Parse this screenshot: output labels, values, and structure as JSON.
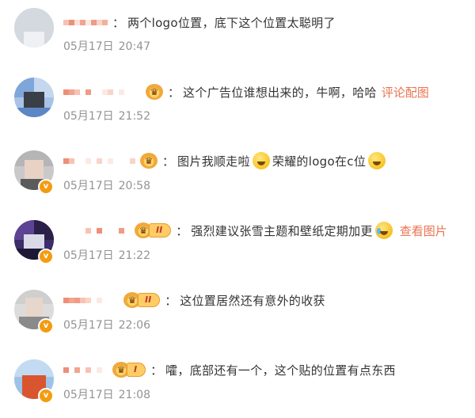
{
  "comments": [
    {
      "text": "两个logo位置，底下这个位置太聪明了",
      "date": "05月17日",
      "time": "20:47"
    },
    {
      "text": "这个广告位谁想出来的，牛啊，哈哈",
      "link": "评论配图",
      "date": "05月17日",
      "time": "21:52"
    },
    {
      "text_a": "图片我顺走啦",
      "text_b": "荣耀的logo在c位",
      "date": "05月17日",
      "time": "20:58"
    },
    {
      "badge": "II",
      "text": "强烈建议张雪主题和壁纸定期加更",
      "link": "查看图片",
      "date": "05月17日",
      "time": "21:22"
    },
    {
      "badge": "II",
      "text": "这位置居然还有意外的收获",
      "date": "05月17日",
      "time": "22:06"
    },
    {
      "badge": "I",
      "text": "嚯，底部还有一个，这个贴的位置有点东西",
      "date": "05月17日",
      "time": "21:08"
    }
  ],
  "colon": "：",
  "verified_mark": "v",
  "colors": {
    "text": "#333333",
    "time": "#939393",
    "link": "#eb7350",
    "badge": "#ffcc66"
  }
}
